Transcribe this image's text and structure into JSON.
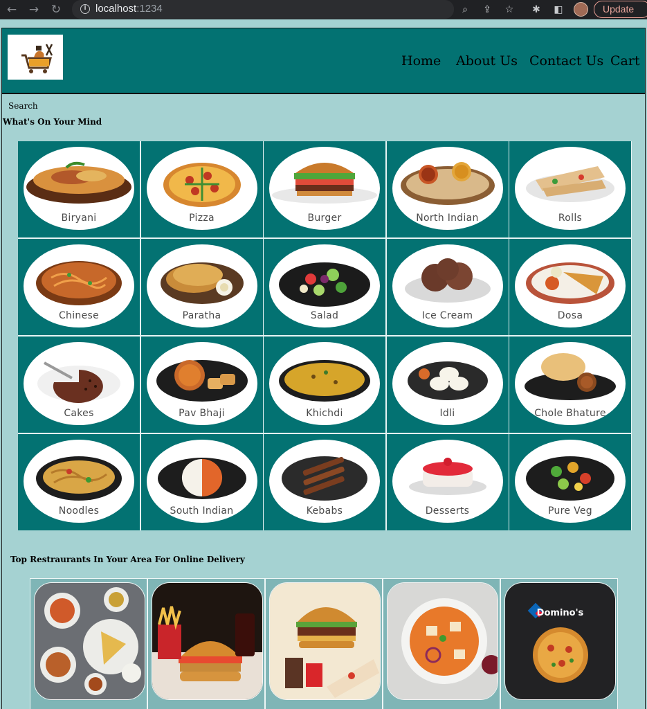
{
  "browser": {
    "url_host": "localhost",
    "url_port": ":1234",
    "update_label": "Update"
  },
  "header": {
    "nav": [
      "Home",
      "About Us",
      "Contact Us",
      "Cart"
    ]
  },
  "search_label": "Search",
  "mind_title": "What's On Your Mind",
  "categories": [
    {
      "label": "Biryani",
      "icon": "biryani-dish"
    },
    {
      "label": "Pizza",
      "icon": "pizza-dish"
    },
    {
      "label": "Burger",
      "icon": "burger-dish"
    },
    {
      "label": "North Indian",
      "icon": "north-indian-dish"
    },
    {
      "label": "Rolls",
      "icon": "rolls-dish"
    },
    {
      "label": "Chinese",
      "icon": "chinese-dish"
    },
    {
      "label": "Paratha",
      "icon": "paratha-dish"
    },
    {
      "label": "Salad",
      "icon": "salad-dish"
    },
    {
      "label": "Ice Cream",
      "icon": "ice-cream-dish"
    },
    {
      "label": "Dosa",
      "icon": "dosa-dish"
    },
    {
      "label": "Cakes",
      "icon": "cake-dish"
    },
    {
      "label": "Pav Bhaji",
      "icon": "pav-bhaji-dish"
    },
    {
      "label": "Khichdi",
      "icon": "khichdi-dish"
    },
    {
      "label": "Idli",
      "icon": "idli-dish"
    },
    {
      "label": "Chole Bhature",
      "icon": "chole-bhature-dish"
    },
    {
      "label": "Noodles",
      "icon": "noodles-dish"
    },
    {
      "label": "South Indian",
      "icon": "south-indian-dish"
    },
    {
      "label": "Kebabs",
      "icon": "kebabs-dish"
    },
    {
      "label": "Desserts",
      "icon": "desserts-dish"
    },
    {
      "label": "Pure Veg",
      "icon": "pure-veg-dish"
    }
  ],
  "restaurants_title": "Top Restraurants In Your Area For Online Delivery",
  "restaurants": [
    {
      "icon": "thali-platter-image"
    },
    {
      "icon": "burger-fries-image"
    },
    {
      "icon": "burger-wrap-combo-image"
    },
    {
      "icon": "curry-bowl-image"
    },
    {
      "icon": "dominos-pizza-image",
      "brand": "Domino's"
    }
  ],
  "colors": {
    "header_bg": "#037272",
    "page_bg": "#a5d2d2",
    "tile_bg": "#037272"
  }
}
